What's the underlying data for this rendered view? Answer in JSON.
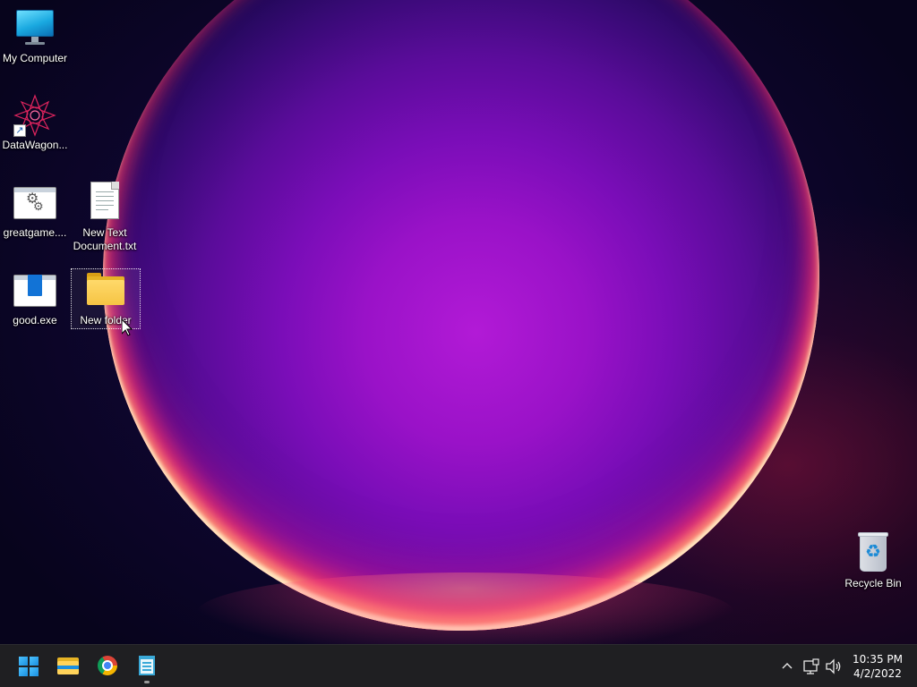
{
  "desktop": {
    "icons": [
      {
        "label": "My Computer",
        "icon": "monitor-icon"
      },
      {
        "label": "DataWagon...",
        "icon": "datawagon-icon"
      },
      {
        "label": "greatgame....",
        "icon": "gear-window-icon"
      },
      {
        "label": "New Text Document.txt",
        "icon": "text-document-icon"
      },
      {
        "label": "good.exe",
        "icon": "app-window-icon"
      },
      {
        "label": "New folder",
        "icon": "folder-icon"
      },
      {
        "label": "Recycle Bin",
        "icon": "recycle-bin-icon"
      }
    ],
    "selected": "New folder"
  },
  "taskbar": {
    "pinned": [
      {
        "name": "Start",
        "icon": "windows-start-icon"
      },
      {
        "name": "File Explorer",
        "icon": "file-explorer-icon"
      },
      {
        "name": "Google Chrome",
        "icon": "chrome-icon"
      },
      {
        "name": "Notepad",
        "icon": "notepad-icon",
        "running": true
      }
    ],
    "tray": {
      "icons": [
        "chevron-up-icon",
        "network-icon",
        "volume-icon"
      ],
      "time": "10:35 PM",
      "date": "4/2/2022"
    }
  },
  "colors": {
    "taskbar_bg": "#1f1f22",
    "accent": "#1a8fe0"
  }
}
